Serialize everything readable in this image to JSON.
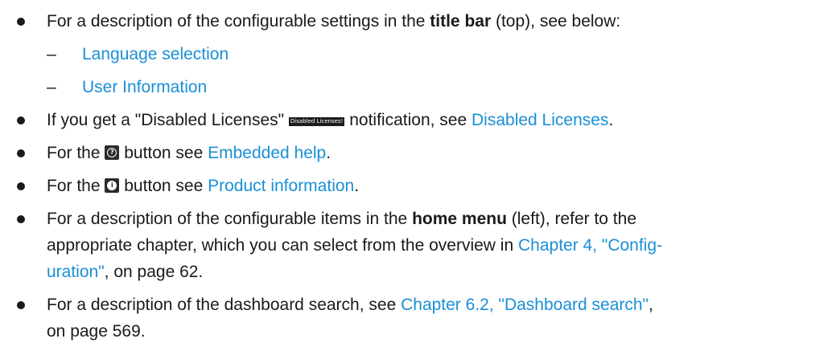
{
  "items": [
    {
      "pre": "For a description of the configurable settings in the ",
      "bold": "title bar",
      "post": " (top), see below:"
    },
    {
      "pre": "If you get a \"Disabled Licenses\" ",
      "badge": "Disabled Licenses!",
      "mid": " notification, see ",
      "link": "Disabled Licenses",
      "post": "."
    },
    {
      "pre": "For the ",
      "mid": " button see ",
      "link": "Embedded help",
      "post": "."
    },
    {
      "pre": "For the ",
      "mid": " button see ",
      "link": "Product information",
      "post": "."
    },
    {
      "pre": "For a description of the configurable items in the ",
      "bold": "home menu",
      "post": " (left), refer to the",
      "line2": "appropriate chapter, which you can select from the overview in ",
      "link": "Chapter 4, \"Config-",
      "link2": "uration\"",
      "post2": ", on page 62."
    },
    {
      "pre": "For a description of the dashboard search, see ",
      "link": "Chapter 6.2, \"Dashboard search\"",
      "post": ",",
      "line2": "on page 569."
    }
  ],
  "subitems": [
    {
      "dash": "–",
      "link": "Language selection"
    },
    {
      "dash": "–",
      "link": "User Information"
    }
  ],
  "icons": {
    "help_glyph": "?",
    "info_glyph": "i"
  }
}
